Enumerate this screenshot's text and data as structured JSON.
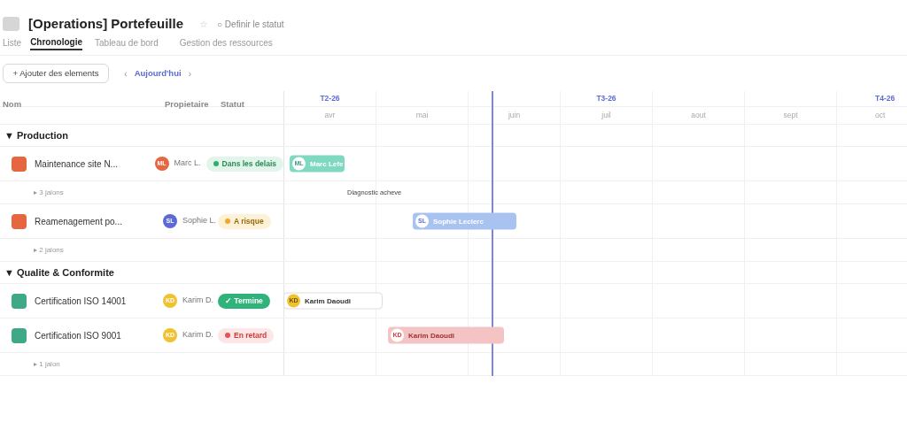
{
  "header": {
    "title": "[Operations] Portefeuille",
    "star": "☆",
    "status_link": "○ Definir le statut"
  },
  "tabs": [
    {
      "label": "Liste",
      "selected": false
    },
    {
      "label": "Chronologie",
      "selected": true
    },
    {
      "label": "Tableau de bord",
      "selected": false
    },
    {
      "label": "Gestion des ressources",
      "selected": false
    }
  ],
  "toolbar": {
    "add_button": "+ Ajouter des elements",
    "prev": "‹",
    "today": "Aujourd'hui",
    "next": "›"
  },
  "columns": [
    "Nom",
    "Propietaire",
    "Statut"
  ],
  "timeline": {
    "quarters": [
      "T2-26",
      "T3-26",
      "T4-26"
    ],
    "months": [
      "avr",
      "mai",
      "juin",
      "juil",
      "aout",
      "sept",
      "oct"
    ]
  },
  "groups": [
    {
      "toggle": "▼",
      "name": "Production",
      "rows": [
        {
          "kind": "task",
          "name": "Maintenance site N...",
          "color": "#e5663f",
          "owner": {
            "initials": "ML",
            "name": "Marc L.",
            "color": "#e5663f"
          },
          "status": {
            "kind": "on_track",
            "label": "Dans les delais"
          },
          "bar": {
            "kind": "teal",
            "initials": "ML",
            "label": "Marc Lefe"
          }
        },
        {
          "kind": "milestones",
          "label": "▸ 3 jalons",
          "milestone": "Diagnostic acheve"
        },
        {
          "kind": "task",
          "name": "Reamenagement po...",
          "color": "#e5663f",
          "owner": {
            "initials": "SL",
            "name": "Sophie L.",
            "color": "#5b6ad6"
          },
          "status": {
            "kind": "at_risk",
            "label": "A risque"
          },
          "bar": {
            "kind": "blue",
            "initials": "SL",
            "label": "Sophie Leclerc"
          }
        },
        {
          "kind": "milestones",
          "label": "▸ 2 jalons"
        }
      ]
    },
    {
      "toggle": "▼",
      "name": "Qualite & Conformite",
      "rows": [
        {
          "kind": "task",
          "name": "Certification ISO 14001",
          "color": "#3fa888",
          "owner": {
            "initials": "KD",
            "name": "Karim D.",
            "color": "#f0c230"
          },
          "status": {
            "kind": "done",
            "label": "✓ Termine"
          },
          "bar": {
            "kind": "outline",
            "initials": "KD",
            "label": "Karim Daoudi"
          }
        },
        {
          "kind": "task",
          "name": "Certification ISO 9001",
          "color": "#3fa888",
          "owner": {
            "initials": "KD",
            "name": "Karim D.",
            "color": "#f0c230"
          },
          "status": {
            "kind": "late",
            "label": "En retard"
          },
          "bar": {
            "kind": "red",
            "initials": "KD",
            "label": "Karim Daoudi"
          }
        },
        {
          "kind": "milestones",
          "label": "▸ 1 jalon"
        }
      ]
    }
  ]
}
